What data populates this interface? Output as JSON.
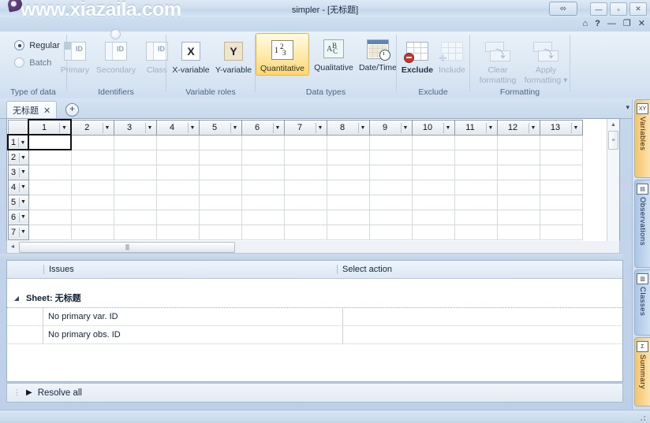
{
  "window": {
    "title": "simpler - [无标题]",
    "watermark": "www.xiazaila.com",
    "restore_glyph": "⬄",
    "minimize": "—",
    "maximize": "▫",
    "close": "✕"
  },
  "subbar": {
    "home_icon": "⌂",
    "help": "?",
    "minimize": "—",
    "restore": "❐",
    "close": "✕"
  },
  "ribbon": {
    "groups": [
      {
        "name": "type-of-data",
        "label": "Type of data",
        "options": [
          {
            "label": "Regular",
            "selected": true
          },
          {
            "label": "Batch",
            "selected": false
          }
        ]
      },
      {
        "name": "identifiers",
        "label": "Identifiers",
        "buttons": [
          {
            "label": "Primary",
            "icon": "id-icon",
            "enabled": false
          },
          {
            "label": "Secondary",
            "icon": "id-icon",
            "enabled": false
          },
          {
            "label": "Class",
            "icon": "id-icon",
            "enabled": false
          }
        ]
      },
      {
        "name": "variable-roles",
        "label": "Variable roles",
        "buttons": [
          {
            "label": "X-variable",
            "icon": "x-box-icon",
            "enabled": true
          },
          {
            "label": "Y-variable",
            "icon": "y-box-icon",
            "enabled": true
          }
        ]
      },
      {
        "name": "data-types",
        "label": "Data types",
        "buttons": [
          {
            "label": "Quantitative",
            "icon": "numbers-icon",
            "enabled": true,
            "selected": true
          },
          {
            "label": "Qualitative",
            "icon": "abc-icon",
            "enabled": true
          },
          {
            "label": "Date/Time",
            "icon": "calendar-clock-icon",
            "enabled": true
          }
        ]
      },
      {
        "name": "exclude",
        "label": "Exclude",
        "buttons": [
          {
            "label": "Exclude",
            "icon": "table-minus-icon",
            "enabled": true
          },
          {
            "label": "Include",
            "icon": "table-plus-icon",
            "enabled": false
          }
        ]
      },
      {
        "name": "formatting",
        "label": "Formatting",
        "buttons": [
          {
            "label": "Clear\nformatting",
            "line1": "Clear",
            "line2": "formatting",
            "icon": "clear-format-icon",
            "enabled": false
          },
          {
            "label": "Apply\nformatting",
            "line1": "Apply",
            "line2": "formatting ▾",
            "icon": "apply-format-icon",
            "enabled": false
          }
        ]
      }
    ]
  },
  "sheet_tabs": {
    "active_tab": "无标题",
    "close_glyph": "✕",
    "add_glyph": "+",
    "overflow_glyph": "▾"
  },
  "grid": {
    "columns": [
      "1",
      "2",
      "3",
      "4",
      "5",
      "6",
      "7",
      "8",
      "9",
      "10",
      "11",
      "12",
      "13"
    ],
    "rows": [
      "1",
      "2",
      "3",
      "4",
      "5",
      "6",
      "7"
    ],
    "active_cell": {
      "row": 1,
      "col": 1,
      "value": ""
    },
    "dropdown_glyph": "▼",
    "scroll_up_glyph": "▲",
    "scroll_down_glyph": "▼",
    "scroll_left_glyph": "◄",
    "scroll_right_glyph": "►"
  },
  "issues_panel": {
    "headers": [
      "",
      "Issues",
      "Select action"
    ],
    "groups": [
      {
        "title": "Sheet: 无标题",
        "expanded": true,
        "expand_glyph": "◢",
        "rows": [
          {
            "issue": "No primary var. ID",
            "action": ""
          },
          {
            "issue": "No primary obs. ID",
            "action": ""
          }
        ]
      }
    ]
  },
  "resolve_bar": {
    "label": "Resolve all",
    "triangle": "▶",
    "grip": "⋮"
  },
  "side_tabs": [
    {
      "label": "Variables",
      "icon": "xy-icon",
      "icon_text": "XY",
      "color": "orange",
      "active": true
    },
    {
      "label": "Observations",
      "icon": "rows-icon",
      "icon_text": "▤",
      "color": "blue",
      "active": false
    },
    {
      "label": "Classes",
      "icon": "columns-icon",
      "icon_text": "▥",
      "color": "blue",
      "active": false
    },
    {
      "label": "Summary",
      "icon": "sigma-icon",
      "icon_text": "Σ",
      "color": "orange",
      "active": false
    }
  ],
  "colors": {
    "accent_orange": "#f6c46a",
    "accent_blue": "#a9c6e6",
    "selected_gold": "#ffd76b",
    "chrome_blue": "#c9d9ec"
  }
}
